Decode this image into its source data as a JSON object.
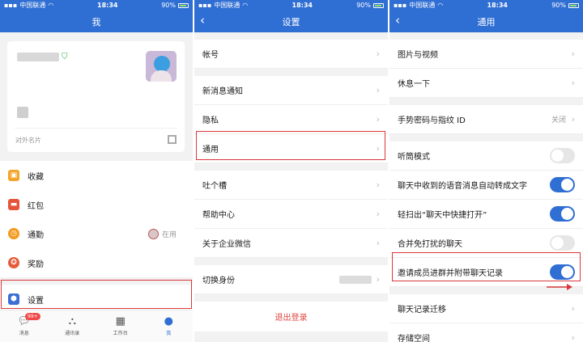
{
  "status": {
    "carrier": "中国联通",
    "time": "18:34",
    "battery": "90%"
  },
  "me": {
    "title": "我",
    "card_label": "对外名片",
    "menu": [
      {
        "label": "收藏",
        "icon": "box-icon"
      },
      {
        "label": "红包",
        "icon": "red-envelope-icon"
      },
      {
        "label": "通勤",
        "icon": "clock-icon",
        "right": "在用"
      },
      {
        "label": "奖励",
        "icon": "medal-icon"
      },
      {
        "label": "设置",
        "icon": "settings-icon"
      }
    ],
    "tabs": [
      {
        "label": "消息",
        "badge": "99+"
      },
      {
        "label": "通讯录"
      },
      {
        "label": "工作台"
      },
      {
        "label": "我"
      }
    ]
  },
  "settings": {
    "title": "设置",
    "items": [
      "帐号",
      "新消息通知",
      "隐私",
      "通用",
      "吐个槽",
      "帮助中心",
      "关于企业微信",
      "切换身份"
    ],
    "logout": "退出登录"
  },
  "general": {
    "title": "通用",
    "items": [
      {
        "label": "图片与视频"
      },
      {
        "label": "休息一下"
      },
      {
        "label": "手势密码与指纹 ID",
        "value": "关闭"
      },
      {
        "label": "听筒模式",
        "toggle": false
      },
      {
        "label": "聊天中收到的语音消息自动转成文字",
        "toggle": true
      },
      {
        "label": "轻扫出“聊天中快捷打开”",
        "toggle": true
      },
      {
        "label": "合并免打扰的聊天",
        "toggle": false
      },
      {
        "label": "邀请成员进群并附带聊天记录",
        "toggle": true
      },
      {
        "label": "聊天记录迁移"
      },
      {
        "label": "存储空间"
      }
    ]
  },
  "colors": {
    "brand": "#2f6ed3",
    "highlight": "#d9383c",
    "danger": "#e0453e"
  }
}
